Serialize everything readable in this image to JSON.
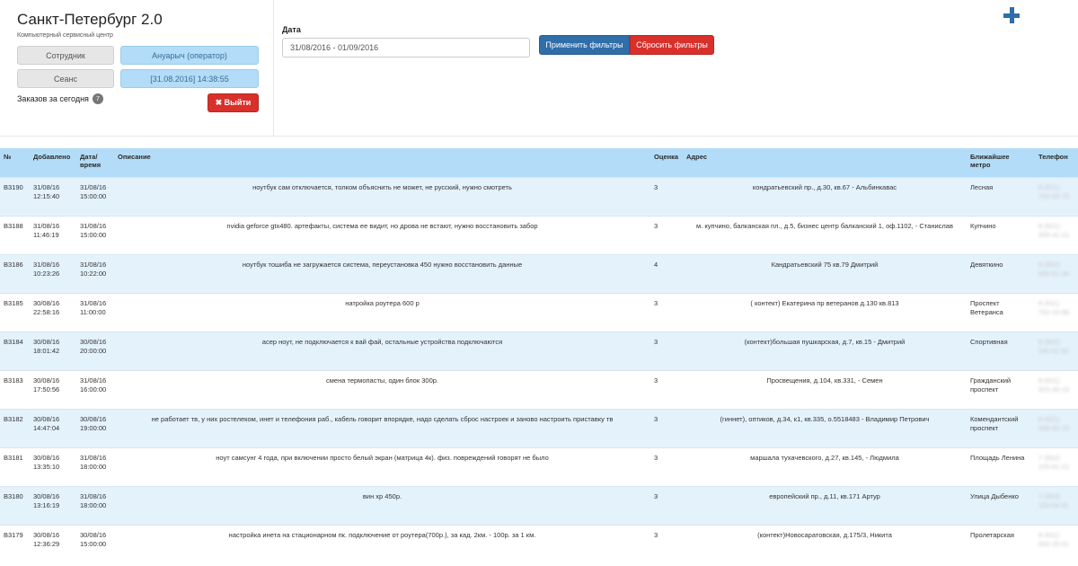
{
  "app": {
    "title": "Санкт-Петербург 2.0",
    "subtitle": "Компьютерный сервисный центр"
  },
  "user_panel": {
    "employee_label": "Сотрудник",
    "employee_value": "Ануарыч (оператор)",
    "session_label": "Сеанс",
    "session_value": "[31.08.2016] 14:38:55",
    "orders_today_label": "Заказов за сегодня",
    "orders_today_count": "7",
    "logout_label": "✖ Выйти"
  },
  "filters": {
    "date_label": "Дата",
    "date_value": "31/08/2016 - 01/09/2016",
    "apply_label": "Применить фильтры",
    "reset_label": "Сбросить фильтры",
    "add_icon": "plus-icon"
  },
  "colors": {
    "primary": "#2f6ea9",
    "danger": "#d9302c",
    "header_bg": "#b3dcf8",
    "row_alt": "#e4f2fc"
  },
  "table": {
    "columns": [
      "№",
      "Добавлено",
      "Дата/ время",
      "Описание",
      "Оценка",
      "Адрес",
      "Ближайшее метро",
      "Телефон"
    ],
    "rows": [
      {
        "id": "B3190",
        "added": "31/08/16 12:15:40",
        "date": "31/08/16 15:00:00",
        "desc": "ноутбук сам отключается, толком объяснить не может, не русский, нужно смотреть",
        "score": "3",
        "addr": "кондратьевский пр., д.30, кв.67 - Альбинкавас",
        "metro": "Лесная",
        "phone": "8 (911) 755-55-75"
      },
      {
        "id": "B3188",
        "added": "31/08/16 11:46:19",
        "date": "31/08/16 15:00:00",
        "desc": "nvidia geforce gtx480. артефакты, система ее видит, но дрова не встают, нужно восстановить забор",
        "score": "3",
        "addr": "м. купчино, балканская пл., д.5, бизнес центр балканский 1, оф.1102, - Станислав",
        "metro": "Купчино",
        "phone": "8 (921) 555-41-21"
      },
      {
        "id": "B3186",
        "added": "31/08/16 10:23:26",
        "date": "31/08/16 10:22:00",
        "desc": "ноутбук тошиба не загружается система, переустановка 450 нужно восстановить данные",
        "score": "4",
        "addr": "Кандратьевский 75 кв.79 Дмитрий",
        "metro": "Девяткино",
        "phone": "8 (952) 895-51-34"
      },
      {
        "id": "B3185",
        "added": "30/08/16 22:58:16",
        "date": "31/08/16 11:00:00",
        "desc": "натройка роутера 600 р",
        "score": "3",
        "addr": "( контект) Екатерина пр ветеранов д.130 кв.813",
        "metro": "Проспект Ветеранса",
        "phone": "8 (911) 752-15-88"
      },
      {
        "id": "B3184",
        "added": "30/08/16 18:01:42",
        "date": "30/08/16 20:00:00",
        "desc": "асер ноут, не подключается к вай фай, остальные устройства подключаются",
        "score": "3",
        "addr": "(контект)большая пушкарская, д.7, кв.15 - Дмитрий",
        "metro": "Спортивная",
        "phone": "8 (905) 540-51-60"
      },
      {
        "id": "B3183",
        "added": "30/08/16 17:50:56",
        "date": "31/08/16 16:00:00",
        "desc": "смена термопасты, один блок 300р.",
        "score": "3",
        "addr": "Просвещения, д.104, кв.331, - Семен",
        "metro": "Гражданский проспект",
        "phone": "8 (911) 915-30-15"
      },
      {
        "id": "B3182",
        "added": "30/08/16 14:47:04",
        "date": "30/08/16 19:00:00",
        "desc": "не работает тв, у них ростелеком, инет и телефония раб., кабель говорит впорядке, надо сделать сброс настроек и заново настроить приставку тв",
        "score": "3",
        "addr": "(гиннет), оптиков, д.34, к1, кв.335, о.5518483 - Владимир Петрович",
        "metro": "Комендантский проспект",
        "phone": "8 (921) 648-83-10"
      },
      {
        "id": "B3181",
        "added": "30/08/16 13:35:10",
        "date": "31/08/16 18:00:00",
        "desc": "ноут самсунг 4 года, при включении просто белый экран (матрица 4к). физ. повреждений говорят не было",
        "score": "3",
        "addr": "маршала тухачевского, д.27, кв.145, - Людмила",
        "metro": "Площадь Ленина",
        "phone": "7 (952) 225-61-21"
      },
      {
        "id": "B3180",
        "added": "30/08/16 13:16:19",
        "date": "31/08/16 18:00:00",
        "desc": "вин хр 450р.",
        "score": "3",
        "addr": "европейский пр., д.11, кв.171 Артур",
        "metro": "Улица Дыбенко",
        "phone": "7 (953) 153-04-91"
      },
      {
        "id": "B3179",
        "added": "30/08/16 12:36:29",
        "date": "30/08/16 15:00:00",
        "desc": "настройка инета на стационарном пк. подключение от роутера(700р.), за кад. 2км. - 100р. за 1 км.",
        "score": "3",
        "addr": "(контект)Новосаратовская, д.175/3, Никита",
        "metro": "Пролетарская",
        "phone": "8 (911) 832-25-51"
      }
    ]
  }
}
